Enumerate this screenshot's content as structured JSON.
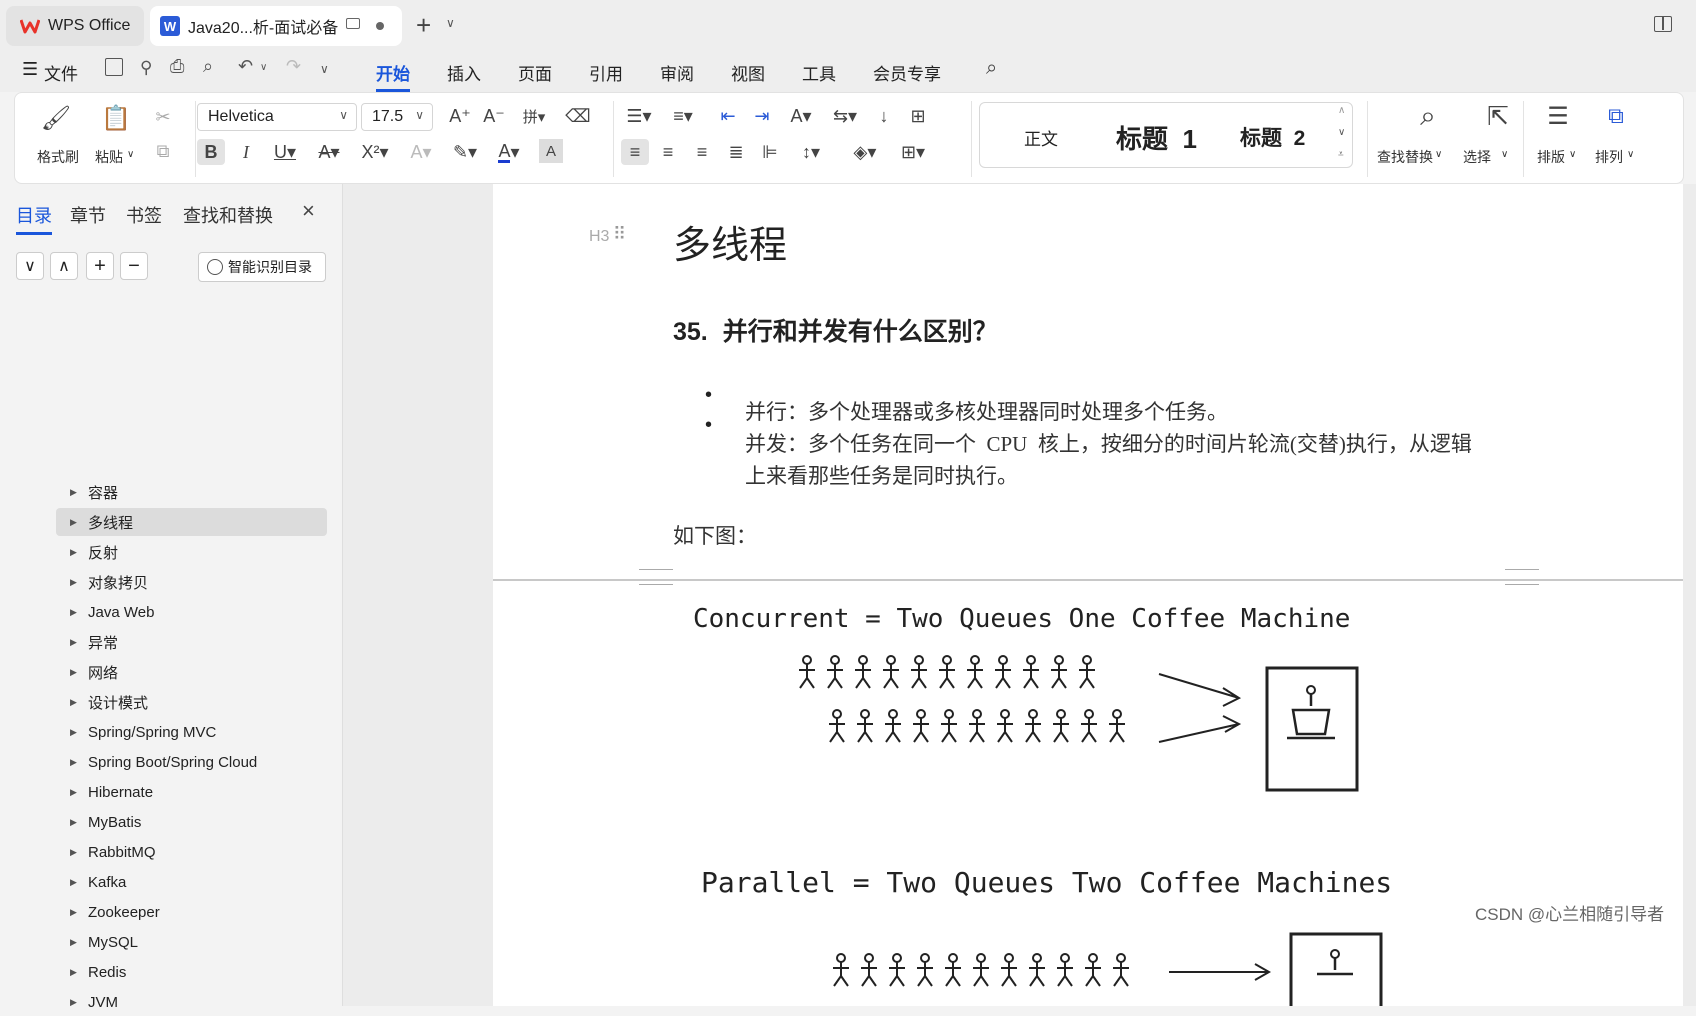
{
  "tabs": {
    "app": "WPS Office",
    "doc": "Java20...析-面试必备"
  },
  "menu": {
    "file": "文件",
    "items": [
      "开始",
      "插入",
      "页面",
      "引用",
      "审阅",
      "视图",
      "工具",
      "会员专享"
    ],
    "active": "开始"
  },
  "ribbon": {
    "format_painter": "格式刷",
    "paste": "粘贴",
    "font_name": "Helvetica",
    "font_size": "17.5",
    "styles": {
      "normal": "正文",
      "h1": "标题  1",
      "h2": "标题  2"
    },
    "find_replace": "查找替换",
    "select": "选择",
    "layout": "排版",
    "arrange": "排列"
  },
  "sidebar": {
    "tabs": [
      "目录",
      "章节",
      "书签",
      "查找和替换"
    ],
    "smart_toc": "智能识别目录",
    "items": [
      "容器",
      "多线程",
      "反射",
      "对象拷贝",
      "Java Web",
      "异常",
      "网络",
      "设计模式",
      "Spring/Spring MVC",
      "Spring Boot/Spring Cloud",
      "Hibernate",
      "MyBatis",
      "RabbitMQ",
      "Kafka",
      "Zookeeper",
      "MySQL",
      "Redis",
      "JVM"
    ],
    "selected": "多线程"
  },
  "doc": {
    "heading_marker": "H3",
    "heading": "多线程",
    "question_num": "35.",
    "question": "并行和并发有什么区别？",
    "bullet1": "并行：多个处理器或多核处理器同时处理多个任务。",
    "bullet2a": "并发：多个任务在同一个  CPU  核上，按细分的时间片轮流(交替)执行，从逻辑",
    "bullet2b": "上来看那些任务是同时执行。",
    "as_below": "如下图：",
    "img_line1": "Concurrent = Two Queues One Coffee Machine",
    "img_line2": "Parallel = Two Queues Two Coffee Machines"
  },
  "watermark": "CSDN @心兰相随引导者"
}
